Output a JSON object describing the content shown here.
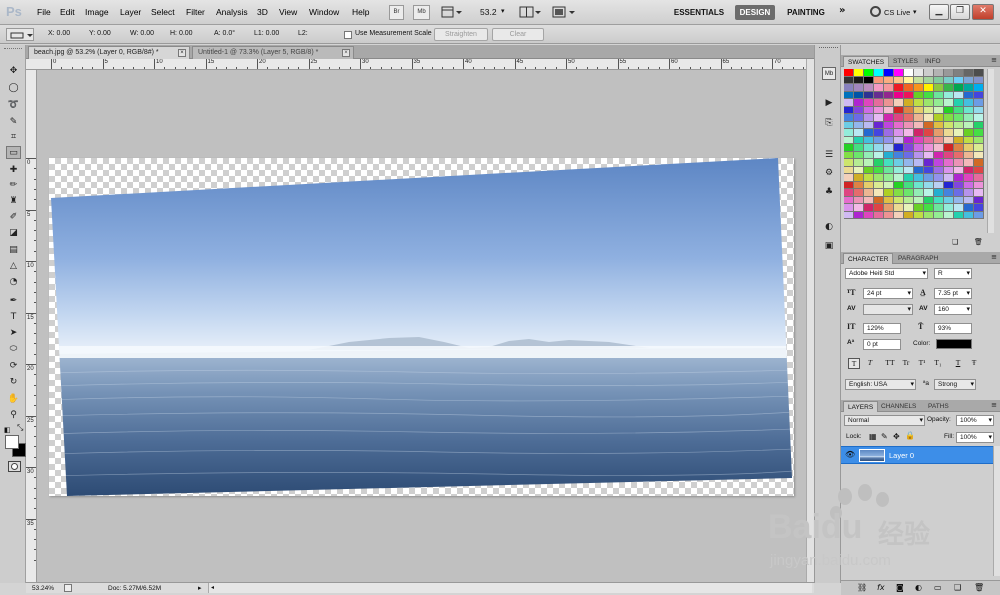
{
  "app": {
    "logo": "Ps"
  },
  "menu": [
    "File",
    "Edit",
    "Image",
    "Layer",
    "Select",
    "Filter",
    "Analysis",
    "3D",
    "View",
    "Window",
    "Help"
  ],
  "app_bar": {
    "bridge_label": "Br",
    "minibridge_label": "Mb",
    "zoom_value": "53.2",
    "workspaces": [
      "ESSENTIALS",
      "DESIGN",
      "PAINTING"
    ],
    "active_workspace": "DESIGN",
    "overflow": "»",
    "cs_live": "CS Live"
  },
  "options_bar": {
    "x": "X: 0.00",
    "y": "Y: 0.00",
    "w": "W: 0.00",
    "h": "H: 0.00",
    "a": "A: 0.0°",
    "l1": "L1: 0.00",
    "l2": "L2:",
    "measurement_scale_label": "Use Measurement Scale",
    "straighten_label": "Straighten",
    "clear_label": "Clear"
  },
  "tabs": [
    {
      "label": "beach.jpg @ 53.2% (Layer 0, RGB/8#) *",
      "active": true
    },
    {
      "label": "Untitled-1 @ 73.3% (Layer 5, RGB/8) *",
      "active": false
    }
  ],
  "ruler": {
    "top_labels": [
      "0",
      "5",
      "10",
      "15",
      "20",
      "25",
      "30",
      "35",
      "40",
      "45",
      "50",
      "55",
      "60",
      "65",
      "70"
    ],
    "left_labels": [
      "0",
      "5",
      "10",
      "15",
      "20",
      "25",
      "30",
      "35"
    ]
  },
  "status": {
    "zoom": "53.24%",
    "doc": "Doc: 5.27M/6.52M"
  },
  "swatches_panel": {
    "tabs": [
      "SWATCHES",
      "STYLES",
      "INFO"
    ],
    "colors": [
      "#ff0000",
      "#ffff00",
      "#00ff00",
      "#00ffff",
      "#0000ff",
      "#ff00ff",
      "#ffffff",
      "#e6e6e6",
      "#cccccc",
      "#b3b3b3",
      "#999999",
      "#808080",
      "#666666",
      "#4d4d4d",
      "#333333",
      "#1a1a1a",
      "#000000",
      "#f7977a",
      "#f9ad81",
      "#fdc68a",
      "#fff79a",
      "#c4df9b",
      "#a3d39c",
      "#82ca9d",
      "#7bcdc8",
      "#6ecff6",
      "#7ea7d8",
      "#8493ca",
      "#8882be",
      "#a187be",
      "#bc8dbf",
      "#f49ac2",
      "#f6989d",
      "#ed1c24",
      "#f26522",
      "#f7941d",
      "#fff200",
      "#8dc73f",
      "#39b54a",
      "#00a651",
      "#00a99d",
      "#00aeef",
      "#0072bc",
      "#0054a6",
      "#2e3192",
      "#662d91",
      "#92278f",
      "#ec008c",
      "#ed145b"
    ],
    "color_model": "hsl-diagonal"
  },
  "character_panel": {
    "tabs": [
      "CHARACTER",
      "PARAGRAPH"
    ],
    "font_family": "Adobe Heiti Std",
    "font_style": "R",
    "font_size": "24 pt",
    "leading": "7.35 pt",
    "kerning": "",
    "tracking": "160",
    "vertical_scale": "129%",
    "horizontal_scale": "93%",
    "baseline_shift": "0 pt",
    "color_label": "Color:",
    "color_value": "#000000",
    "style_buttons": [
      "T",
      "T",
      "TT",
      "Tr",
      "T¹",
      "T₁",
      "T",
      "Ŧ"
    ],
    "language": "English: USA",
    "aa_prefix": "ªa",
    "antialias": "Strong"
  },
  "layers_panel": {
    "tabs": [
      "LAYERS",
      "CHANNELS",
      "PATHS"
    ],
    "blend_mode": "Normal",
    "opacity_label": "Opacity:",
    "opacity": "100%",
    "lock_label": "Lock:",
    "fill_label": "Fill:",
    "fill": "100%",
    "layer_name": "Layer 0"
  },
  "watermark": {
    "brand": "Baidu",
    "cn": "经验",
    "url": "jingyan.baidu.com"
  }
}
